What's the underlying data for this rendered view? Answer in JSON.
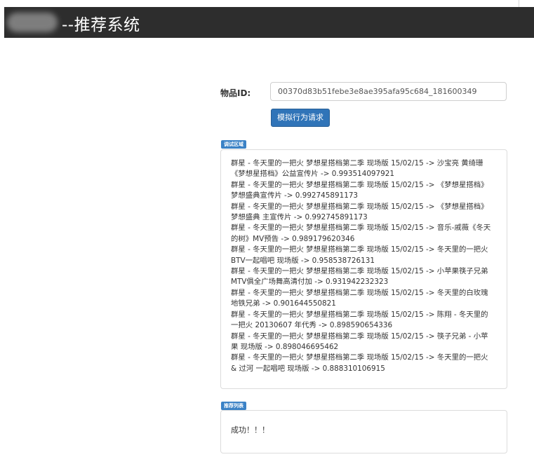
{
  "header": {
    "title_visible": "--推荐系统"
  },
  "form": {
    "item_id_label": "物品ID:",
    "item_id_value": "00370d83b51febe3e8ae395afa95c684_181600349",
    "simulate_button_label": "模拟行为请求"
  },
  "debug": {
    "badge": "调试区域",
    "lines": [
      "群星 - 冬天里的一把火 梦想星搭档第二季 现场版 15/02/15 -> 沙宝亮 黄绮珊",
      "《梦想星搭档》公益宣传片 -> 0.993514097921",
      "群星 - 冬天里的一把火 梦想星搭档第二季 现场版 15/02/15 -> 《梦想星搭档》",
      "梦想盛典宣传片 -> 0.992745891173",
      "群星 - 冬天里的一把火 梦想星搭档第二季 现场版 15/02/15 -> 《梦想星搭档》",
      "梦想盛典 主宣传片 -> 0.992745891173",
      "群星 - 冬天里的一把火 梦想星搭档第二季 现场版 15/02/15 -> 音乐-戚薇《冬天",
      "的树》MV预告 -> 0.989179620346",
      "群星 - 冬天里的一把火 梦想星搭档第二季 现场版 15/02/15 -> 冬天里的一把火",
      "BTV一起唱吧 现场版 -> 0.958538726131",
      "群星 - 冬天里的一把火 梦想星搭档第二季 现场版 15/02/15 -> 小苹果筷子兄弟",
      "MTV俱全广场舞高清付加 -> 0.931942232323",
      "群星 - 冬天里的一把火 梦想星搭档第二季 现场版 15/02/15 -> 冬天里的白玫瑰",
      "地铁兄弟 -> 0.901644550821",
      "群星 - 冬天里的一把火 梦想星搭档第二季 现场版 15/02/15 -> 陈翔 - 冬天里的",
      "一把火 20130607 年代秀 -> 0.898590654336",
      "群星 - 冬天里的一把火 梦想星搭档第二季 现场版 15/02/15 -> 筷子兄弟 - 小苹",
      "果 现场版 -> 0.898046695462",
      "群星 - 冬天里的一把火 梦想星搭档第二季 现场版 15/02/15 -> 冬天里的一把火",
      "& 过河 一起唱吧 现场版 -> 0.888310106915"
    ]
  },
  "recommend": {
    "badge": "推荐列表",
    "result_text": "成功！！！"
  },
  "colors": {
    "header_bg": "#2d2d2d",
    "primary_button": "#3074b8",
    "badge_bg": "#3b82c6"
  }
}
